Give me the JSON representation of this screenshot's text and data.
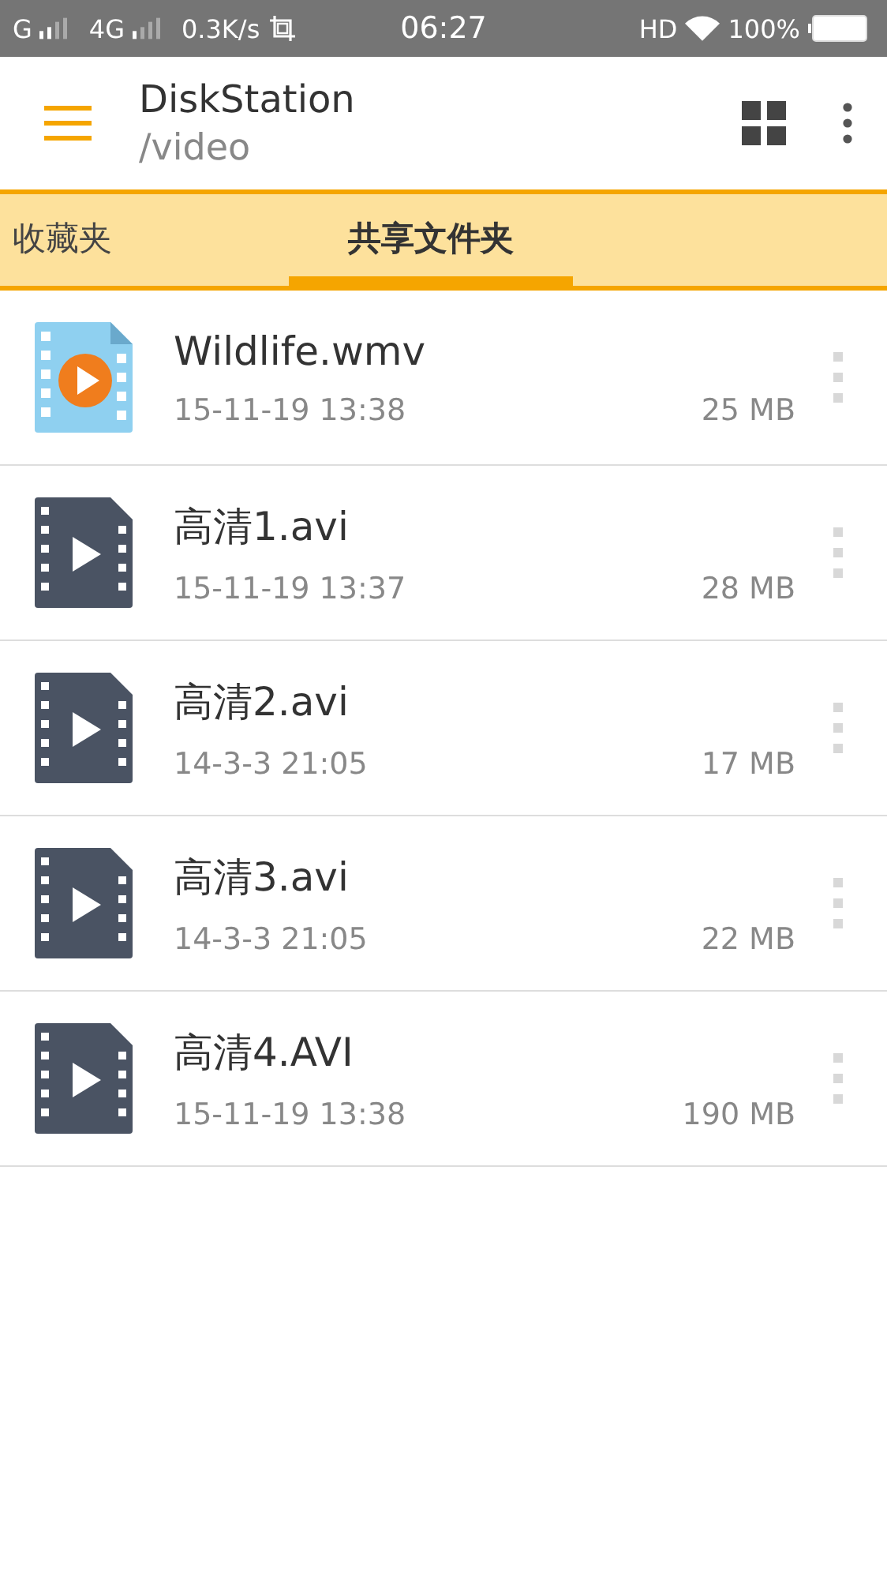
{
  "status_bar": {
    "network_1": "G",
    "network_2": "4G",
    "speed": "0.3K/s",
    "time": "06:27",
    "hd": "HD",
    "battery": "100%"
  },
  "toolbar": {
    "title": "DiskStation",
    "path": "/video"
  },
  "tabs": [
    {
      "label": "收藏夹",
      "selected": false
    },
    {
      "label": "共享文件夹",
      "selected": true
    }
  ],
  "files": [
    {
      "name": "Wildlife.wmv",
      "kind": "wmv",
      "date": "15-11-19 13:38",
      "size": "25 MB"
    },
    {
      "name": "高清1.avi",
      "kind": "video",
      "date": "15-11-19 13:37",
      "size": "28 MB"
    },
    {
      "name": "高清2.avi",
      "kind": "video",
      "date": "14-3-3 21:05",
      "size": "17 MB"
    },
    {
      "name": "高清3.avi",
      "kind": "video",
      "date": "14-3-3 21:05",
      "size": "22 MB"
    },
    {
      "name": "高清4.AVI",
      "kind": "video",
      "date": "15-11-19 13:38",
      "size": "190 MB"
    }
  ]
}
